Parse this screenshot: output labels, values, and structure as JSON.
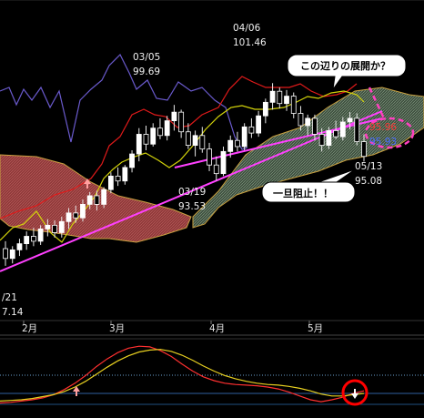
{
  "chart_data": [
    {
      "type": "candlestick",
      "x_months": [
        "2月",
        "3月",
        "4月",
        "5月"
      ],
      "y_range": [
        86,
        106
      ],
      "ohlc": [
        [
          88.0,
          88.6,
          86.6,
          87.2
        ],
        [
          87.2,
          88.2,
          86.8,
          87.9
        ],
        [
          87.9,
          88.8,
          87.4,
          88.4
        ],
        [
          88.4,
          89.4,
          87.9,
          89.0
        ],
        [
          89.0,
          89.7,
          88.2,
          88.6
        ],
        [
          88.6,
          89.9,
          88.3,
          89.6
        ],
        [
          89.6,
          90.4,
          89.0,
          89.9
        ],
        [
          89.9,
          90.3,
          88.9,
          89.3
        ],
        [
          89.3,
          90.6,
          88.9,
          90.2
        ],
        [
          90.2,
          91.3,
          89.6,
          90.9
        ],
        [
          90.9,
          91.5,
          90.1,
          90.5
        ],
        [
          90.5,
          92.0,
          90.2,
          91.6
        ],
        [
          91.6,
          92.6,
          91.2,
          92.3
        ],
        [
          92.3,
          92.7,
          91.1,
          91.6
        ],
        [
          91.6,
          93.0,
          91.3,
          92.8
        ],
        [
          92.8,
          94.2,
          92.5,
          93.9
        ],
        [
          93.9,
          94.6,
          93.1,
          93.5
        ],
        [
          93.5,
          94.8,
          93.2,
          94.6
        ],
        [
          94.6,
          96.0,
          94.2,
          95.7
        ],
        [
          95.7,
          97.8,
          95.1,
          97.3
        ],
        [
          97.3,
          98.0,
          96.0,
          96.5
        ],
        [
          96.5,
          98.2,
          96.3,
          97.8
        ],
        [
          97.8,
          98.6,
          96.9,
          97.2
        ],
        [
          97.2,
          98.8,
          96.8,
          98.4
        ],
        [
          98.4,
          99.69,
          97.6,
          99.1
        ],
        [
          99.1,
          99.3,
          97.0,
          97.5
        ],
        [
          97.5,
          98.2,
          96.1,
          96.4
        ],
        [
          96.4,
          97.6,
          95.5,
          97.2
        ],
        [
          97.2,
          97.9,
          95.8,
          96.1
        ],
        [
          96.1,
          96.6,
          94.3,
          94.8
        ],
        [
          94.8,
          95.5,
          93.53,
          94.1
        ],
        [
          94.1,
          96.3,
          93.9,
          95.9
        ],
        [
          95.9,
          97.2,
          95.4,
          96.8
        ],
        [
          96.8,
          97.5,
          95.9,
          96.3
        ],
        [
          96.3,
          98.2,
          96.0,
          97.9
        ],
        [
          97.9,
          98.6,
          97.0,
          97.4
        ],
        [
          97.4,
          99.2,
          97.1,
          98.8
        ],
        [
          98.8,
          100.2,
          98.2,
          99.9
        ],
        [
          99.9,
          101.46,
          99.3,
          100.8
        ],
        [
          100.8,
          101.1,
          99.4,
          99.8
        ],
        [
          99.8,
          100.9,
          99.2,
          100.4
        ],
        [
          100.4,
          100.7,
          98.6,
          99.0
        ],
        [
          99.0,
          99.6,
          97.6,
          98.0
        ],
        [
          98.0,
          98.9,
          97.2,
          98.6
        ],
        [
          98.6,
          98.9,
          96.8,
          97.3
        ],
        [
          97.3,
          97.8,
          95.9,
          96.4
        ],
        [
          96.4,
          97.9,
          96.1,
          97.6
        ],
        [
          97.6,
          98.4,
          96.9,
          97.1
        ],
        [
          97.1,
          98.7,
          96.8,
          98.3
        ],
        [
          98.3,
          99.1,
          97.7,
          98.6
        ],
        [
          98.6,
          99.0,
          96.4,
          96.7
        ],
        [
          96.7,
          97.3,
          95.08,
          95.5
        ]
      ],
      "annotations": [
        {
          "label": "03/05",
          "value": "99.69"
        },
        {
          "label": "04/06",
          "value": "101.46"
        },
        {
          "label": "03/19",
          "value": "93.53"
        },
        {
          "label": "05/13",
          "value": "95.08"
        },
        {
          "label": "/21",
          "value": "7.14"
        }
      ],
      "price_tags": [
        {
          "text": "95.96",
          "color": "#ff3c3c"
        },
        {
          "text": "95.93",
          "color": "#4a6cff"
        }
      ],
      "callouts": [
        {
          "id": "callout-top",
          "text": "この辺りの展開か？"
        },
        {
          "id": "callout-mid",
          "text": "一旦阻止！！"
        }
      ],
      "lines": {
        "tenkan": {
          "color": "#d2d20a"
        },
        "kijun": {
          "color": "#e01a1a"
        },
        "chikou": {
          "color": "#6a5acd"
        },
        "cloud_bear": {
          "color": "#b84b4b"
        },
        "cloud_bull": {
          "color": "#a0bfa0"
        },
        "trendline": {
          "color": "#ff40ff"
        }
      },
      "markers": [
        {
          "type": "up-arrow",
          "color": "#ffa0a0"
        }
      ]
    },
    {
      "type": "line",
      "panel": "oscillator",
      "series": [
        {
          "color": "#ff3030",
          "values": [
            0.05,
            0.06,
            0.08,
            0.1,
            0.13,
            0.18,
            0.26,
            0.36,
            0.48,
            0.62,
            0.74,
            0.84,
            0.91,
            0.94,
            0.93,
            0.87,
            0.78,
            0.66,
            0.55,
            0.46,
            0.4,
            0.36,
            0.34,
            0.33,
            0.32,
            0.3,
            0.27,
            0.22,
            0.16,
            0.1,
            0.07,
            0.1,
            0.14,
            0.2,
            0.24
          ]
        },
        {
          "color": "#e8d020",
          "values": [
            0.08,
            0.09,
            0.1,
            0.12,
            0.15,
            0.18,
            0.23,
            0.3,
            0.39,
            0.5,
            0.61,
            0.71,
            0.79,
            0.85,
            0.88,
            0.89,
            0.86,
            0.8,
            0.72,
            0.63,
            0.55,
            0.48,
            0.43,
            0.39,
            0.36,
            0.34,
            0.33,
            0.31,
            0.28,
            0.24,
            0.19,
            0.16,
            0.16,
            0.18,
            0.2
          ]
        }
      ],
      "markers": [
        {
          "type": "up-arrow",
          "color": "#ffa0a0"
        },
        {
          "type": "down-arrow",
          "color": "#ffffff",
          "circle": "#ff0000"
        }
      ]
    }
  ]
}
